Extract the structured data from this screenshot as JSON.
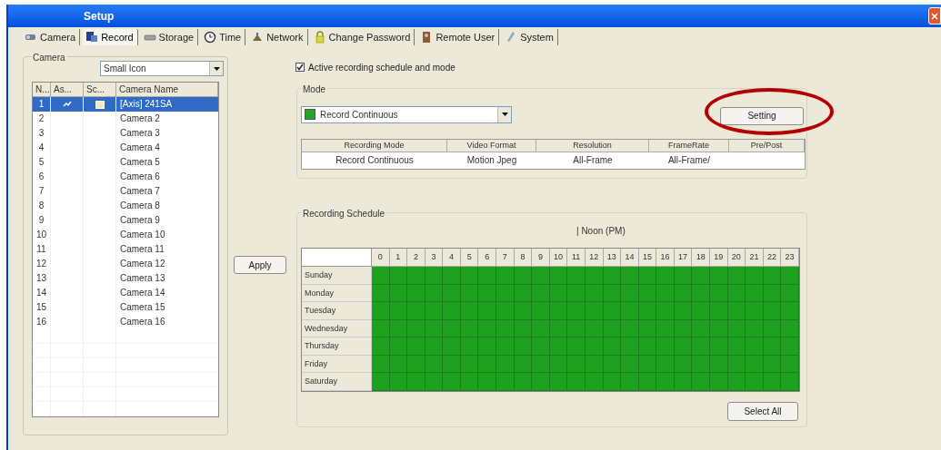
{
  "window": {
    "title": "Setup"
  },
  "tabs": [
    {
      "label": "Camera",
      "selected": false
    },
    {
      "label": "Record",
      "selected": true
    },
    {
      "label": "Storage",
      "selected": false
    },
    {
      "label": "Time",
      "selected": false
    },
    {
      "label": "Network",
      "selected": false
    },
    {
      "label": "Change Password",
      "selected": false
    },
    {
      "label": "Remote User",
      "selected": false
    },
    {
      "label": "System",
      "selected": false
    }
  ],
  "camera_group": {
    "title": "Camera",
    "view_dropdown": "Small Icon",
    "columns": [
      "N...",
      "As...",
      "Sc...",
      "Camera Name"
    ],
    "rows": [
      {
        "number": "1",
        "name": "[Axis] 241SA",
        "selected": true,
        "has_icons": true
      },
      {
        "number": "2",
        "name": "Camera 2",
        "selected": false,
        "has_icons": false
      },
      {
        "number": "3",
        "name": "Camera 3",
        "selected": false,
        "has_icons": false
      },
      {
        "number": "4",
        "name": "Camera 4",
        "selected": false,
        "has_icons": false
      },
      {
        "number": "5",
        "name": "Camera 5",
        "selected": false,
        "has_icons": false
      },
      {
        "number": "6",
        "name": "Camera 6",
        "selected": false,
        "has_icons": false
      },
      {
        "number": "7",
        "name": "Camera 7",
        "selected": false,
        "has_icons": false
      },
      {
        "number": "8",
        "name": "Camera 8",
        "selected": false,
        "has_icons": false
      },
      {
        "number": "9",
        "name": "Camera 9",
        "selected": false,
        "has_icons": false
      },
      {
        "number": "10",
        "name": "Camera 10",
        "selected": false,
        "has_icons": false
      },
      {
        "number": "11",
        "name": "Camera 11",
        "selected": false,
        "has_icons": false
      },
      {
        "number": "12",
        "name": "Camera 12",
        "selected": false,
        "has_icons": false
      },
      {
        "number": "13",
        "name": "Camera 13",
        "selected": false,
        "has_icons": false
      },
      {
        "number": "14",
        "name": "Camera 14",
        "selected": false,
        "has_icons": false
      },
      {
        "number": "15",
        "name": "Camera 15",
        "selected": false,
        "has_icons": false
      },
      {
        "number": "16",
        "name": "Camera 16",
        "selected": false,
        "has_icons": false
      }
    ]
  },
  "apply_button": "Apply",
  "active_schedule": {
    "label": "Active recording schedule and mode",
    "checked": true
  },
  "mode_group": {
    "title": "Mode",
    "dropdown": {
      "value": "Record Continuous",
      "color": "#22a52a"
    },
    "setting_button": "Setting",
    "columns": [
      "Recording Mode",
      "Video Format",
      "Resolution",
      "FrameRate",
      "Pre/Post"
    ],
    "rows": [
      [
        "Record Continuous",
        "Motion Jpeg",
        "All-Frame",
        "All-Frame/",
        null
      ]
    ]
  },
  "schedule_group": {
    "title": "Recording Schedule",
    "noon_label": "| Noon (PM)",
    "hours": [
      "0",
      "1",
      "2",
      "3",
      "4",
      "5",
      "6",
      "7",
      "8",
      "9",
      "10",
      "11",
      "12",
      "13",
      "14",
      "15",
      "16",
      "17",
      "18",
      "19",
      "20",
      "21",
      "22",
      "23"
    ],
    "days": [
      {
        "label": "Sunday",
        "recording": true
      },
      {
        "label": "Monday",
        "recording": true
      },
      {
        "label": "Tuesday",
        "recording": true
      },
      {
        "label": "Wednesday",
        "recording": true
      },
      {
        "label": "Thursday",
        "recording": true
      },
      {
        "label": "Friday",
        "recording": true
      },
      {
        "label": "Saturday",
        "recording": true
      }
    ],
    "select_all_button": "Select All"
  },
  "annotations": [
    {
      "kind": "ellipse",
      "color": "#b40000"
    }
  ]
}
